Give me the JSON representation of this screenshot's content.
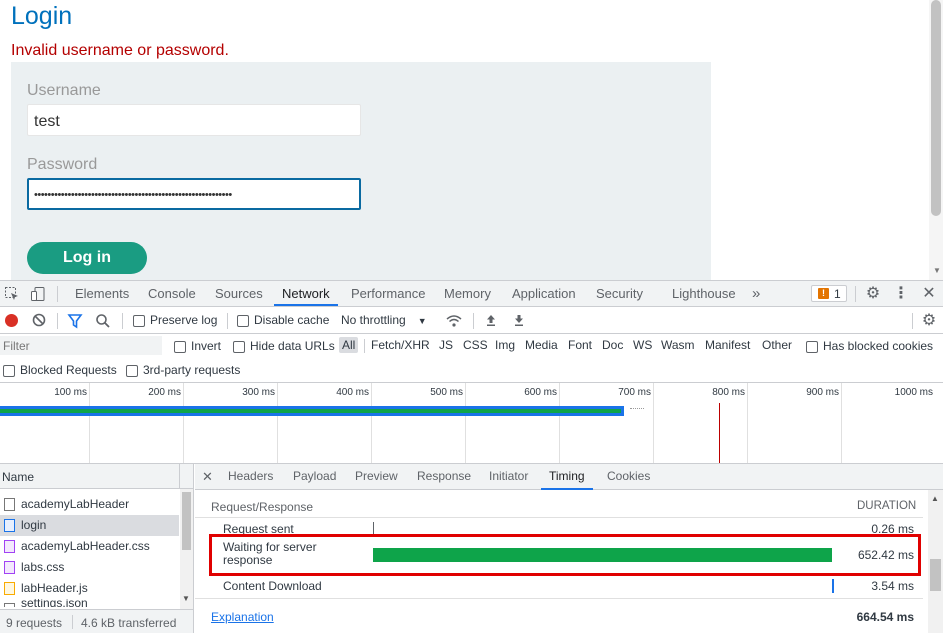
{
  "page": {
    "title": "Login",
    "error": "Invalid username or password.",
    "username_label": "Username",
    "username_value": "test",
    "password_label": "Password",
    "password_value": "•••••••••••••••••••••••••••••••••••••••••••••••••••••••••••",
    "login_button": "Log in"
  },
  "devtools": {
    "tabs": [
      "Elements",
      "Console",
      "Sources",
      "Network",
      "Performance",
      "Memory",
      "Application",
      "Security",
      "Lighthouse"
    ],
    "active_tab": "Network",
    "more_tabs": "»",
    "issues_count": "1",
    "toolbar": {
      "preserve_log": "Preserve log",
      "disable_cache": "Disable cache",
      "throttling": "No throttling"
    },
    "filter": {
      "placeholder": "Filter",
      "invert": "Invert",
      "hide_data_urls": "Hide data URLs",
      "types": [
        "All",
        "Fetch/XHR",
        "JS",
        "CSS",
        "Img",
        "Media",
        "Font",
        "Doc",
        "WS",
        "Wasm",
        "Manifest",
        "Other"
      ],
      "has_blocked_cookies": "Has blocked cookies",
      "blocked_requests": "Blocked Requests",
      "third_party": "3rd-party requests"
    },
    "timeline_ticks": [
      "100 ms",
      "200 ms",
      "300 ms",
      "400 ms",
      "500 ms",
      "600 ms",
      "700 ms",
      "800 ms",
      "900 ms",
      "1000 ms"
    ],
    "request_list": {
      "header": "Name",
      "items": [
        {
          "name": "academyLabHeader",
          "type": "doc"
        },
        {
          "name": "login",
          "type": "doc",
          "selected": true
        },
        {
          "name": "academyLabHeader.css",
          "type": "css"
        },
        {
          "name": "labs.css",
          "type": "css"
        },
        {
          "name": "labHeader.js",
          "type": "js"
        },
        {
          "name": "settings.json",
          "type": "json"
        }
      ]
    },
    "detail_tabs": [
      "Headers",
      "Payload",
      "Preview",
      "Response",
      "Initiator",
      "Timing",
      "Cookies"
    ],
    "active_detail_tab": "Timing",
    "timing": {
      "section": "Request/Response",
      "duration_header": "DURATION",
      "rows": [
        {
          "label": "Request sent",
          "duration": "0.26 ms"
        },
        {
          "label": "Waiting for server response",
          "duration": "652.42 ms"
        },
        {
          "label": "Content Download",
          "duration": "3.54 ms"
        }
      ],
      "explanation": "Explanation",
      "total": "664.54 ms"
    },
    "status": {
      "requests": "9 requests",
      "transferred": "4.6 kB transferred"
    }
  },
  "colors": {
    "waiting_bar": "#0ea44a",
    "highlight_box": "#e00000",
    "accent": "#1a73e8"
  }
}
